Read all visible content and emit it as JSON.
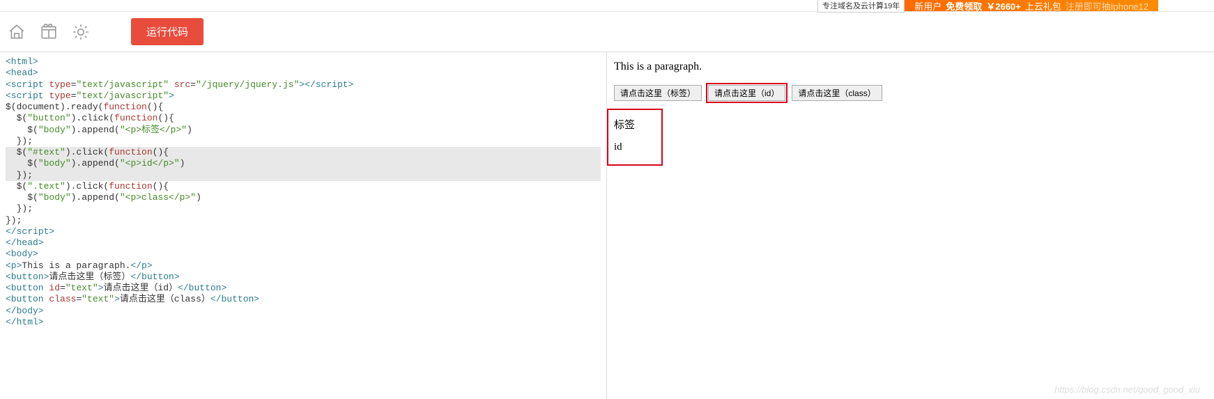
{
  "banner": {
    "left_text": "专注域名及云计算19年",
    "new_user": "新用户",
    "bold1": "免费领取",
    "amount": "￥2660+",
    "gift": "上云礼包",
    "register": "注册即可抽Iphone12"
  },
  "toolbar": {
    "run_label": "运行代码"
  },
  "code": {
    "t_html_o": "<html>",
    "t_head_o": "<head>",
    "l3_a": "<script ",
    "l3_b": "type",
    "l3_c": "=",
    "l3_d": "\"text/javascript\"",
    "l3_e": " src",
    "l3_f": "=",
    "l3_g": "\"/jquery/jquery.js\"",
    "l3_h": "></script>",
    "l4_a": "<script ",
    "l4_b": "type",
    "l4_c": "=",
    "l4_d": "\"text/javascript\"",
    "l4_e": ">",
    "l5": "$(document).ready(",
    "l5_fn": "function",
    "l5_b": "(){",
    "l6_a": "  $(",
    "l6_b": "\"button\"",
    "l6_c": ").click(",
    "l6_fn": "function",
    "l6_d": "(){",
    "l7_a": "    $(",
    "l7_b": "\"body\"",
    "l7_c": ").append(",
    "l7_d": "\"<p>标签</p>\"",
    "l7_e": ")",
    "l8": "  });",
    "l9_a": "  $(",
    "l9_b": "\"#text\"",
    "l9_c": ").click(",
    "l9_fn": "function",
    "l9_d": "(){",
    "l10_a": "    $(",
    "l10_b": "\"body\"",
    "l10_c": ").append(",
    "l10_d": "\"<p>id</p>\"",
    "l10_e": ")",
    "l11": "  });",
    "l12_a": "  $(",
    "l12_b": "\".text\"",
    "l12_c": ").click(",
    "l12_fn": "function",
    "l12_d": "(){",
    "l13_a": "    $(",
    "l13_b": "\"body\"",
    "l13_c": ").append(",
    "l13_d": "\"<p>class</p>\"",
    "l13_e": ")",
    "l14": "  });",
    "l15": "});",
    "t_script_c": "</script>",
    "t_head_c": "</head>",
    "t_body_o": "<body>",
    "l19_a": "<p>",
    "l19_b": "This is a paragraph.",
    "l19_c": "</p>",
    "l20_a": "<button>",
    "l20_b": "请点击这里（标签）",
    "l20_c": "</button>",
    "l21_a": "<button ",
    "l21_b": "id",
    "l21_c": "=",
    "l21_d": "\"text\"",
    "l21_e": ">",
    "l21_f": "请点击这里（id）",
    "l21_g": "</button>",
    "l22_a": "<button ",
    "l22_b": "class",
    "l22_c": "=",
    "l22_d": "\"text\"",
    "l22_e": ">",
    "l22_f": "请点击这里（class）",
    "l22_g": "</button>",
    "t_body_c": "</body>",
    "t_html_c": "</html>"
  },
  "preview": {
    "paragraph": "This is a paragraph.",
    "btn_tag": "请点击这里（标签）",
    "btn_id": "请点击这里（id）",
    "btn_class": "请点击这里（class）",
    "out1": "标签",
    "out2": "id"
  },
  "watermark": "https://blog.csdn.net/good_good_xiu"
}
